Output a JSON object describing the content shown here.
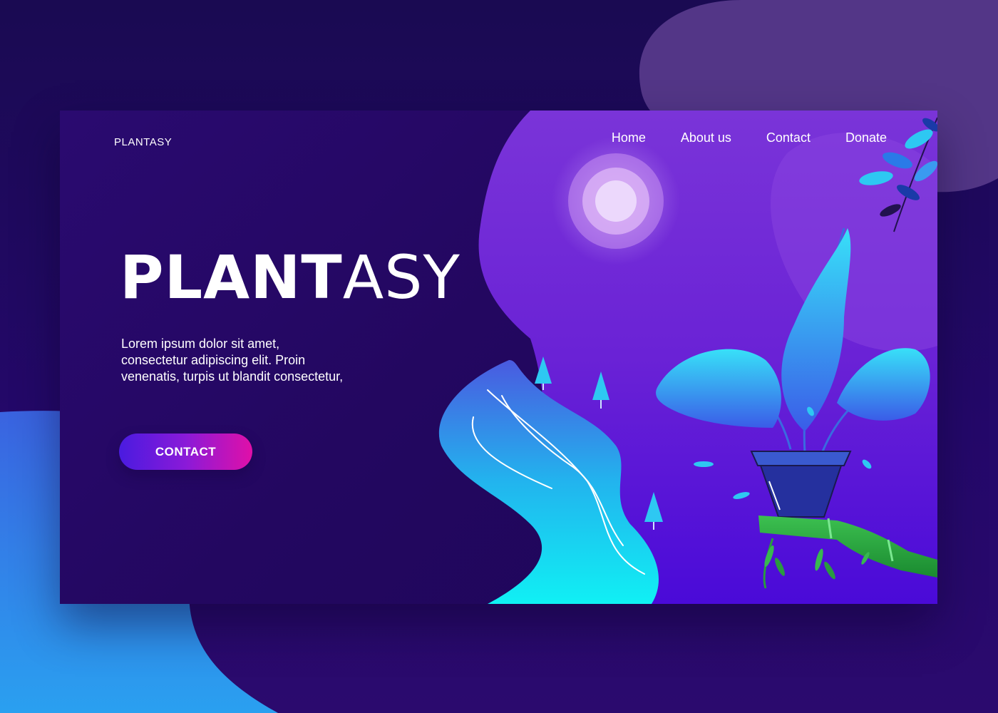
{
  "brand": {
    "logo_text": "PLANTASY"
  },
  "nav": {
    "items": [
      "Home",
      "About us",
      "Contact",
      "Donate"
    ]
  },
  "hero": {
    "title_bold": "PLANT",
    "title_light": "ASY",
    "description": "Lorem ipsum dolor sit amet, consectetur adipiscing elit. Proin venenatis, turpis ut blandit consectetur,",
    "cta_label": "CONTACT"
  },
  "colors": {
    "background": "#1a0a52",
    "card": "#230760",
    "accent_purple": "#8a1ad8",
    "accent_pink": "#e010a8",
    "river_cyan": "#16e6f2",
    "leaf_blue": "#2ec8f2"
  },
  "icons": [
    "moon-illustration",
    "plant-pot-illustration",
    "river-illustration",
    "tree-icon",
    "leaf-icon",
    "bamboo-illustration"
  ]
}
